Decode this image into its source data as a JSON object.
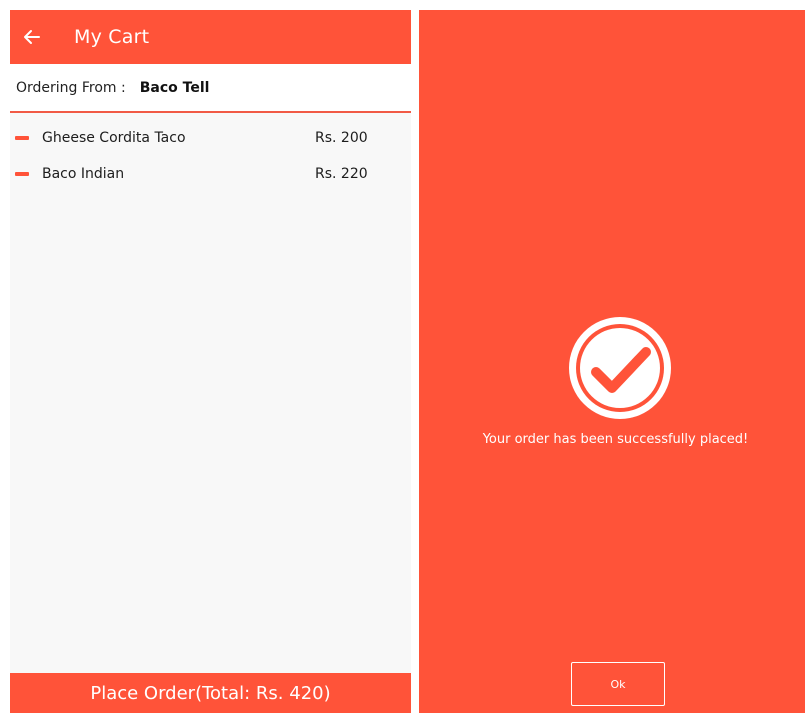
{
  "cart": {
    "title": "My Cart",
    "ordering_from_label": "Ordering From :",
    "restaurant": "Baco Tell",
    "items": [
      {
        "name": "Gheese Cordita Taco",
        "price": "Rs. 200"
      },
      {
        "name": "Baco Indian",
        "price": "Rs. 220"
      }
    ],
    "place_order_label": "Place Order(Total: Rs. 420)"
  },
  "success": {
    "message": "Your order has been successfully placed!",
    "ok_label": "Ok"
  },
  "icons": {
    "back": "back-arrow-icon",
    "remove": "minus-icon",
    "check": "check-circle-icon"
  },
  "colors": {
    "accent": "#ff5339",
    "text_on_accent": "#ffffff"
  }
}
